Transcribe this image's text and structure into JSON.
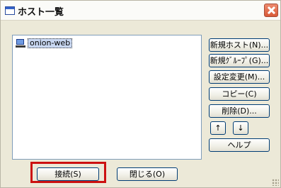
{
  "window": {
    "title": "ホスト一覧"
  },
  "hosts": [
    {
      "name": "onion-web"
    }
  ],
  "side_buttons": {
    "new_host": "新規ホスト(N)...",
    "new_group": "新規ｸﾞﾙｰﾌﾟ(G)...",
    "edit": "設定変更(M)...",
    "copy": "コピー(C)",
    "delete": "削除(D)...",
    "up": "↑",
    "down": "↓",
    "help": "ヘルプ"
  },
  "bottom_buttons": {
    "connect": "接続(S)",
    "close": "閉じる(O)"
  },
  "colors": {
    "highlight": "#cc1111",
    "selection": "#c9d8f2",
    "button_border": "#003c74"
  }
}
